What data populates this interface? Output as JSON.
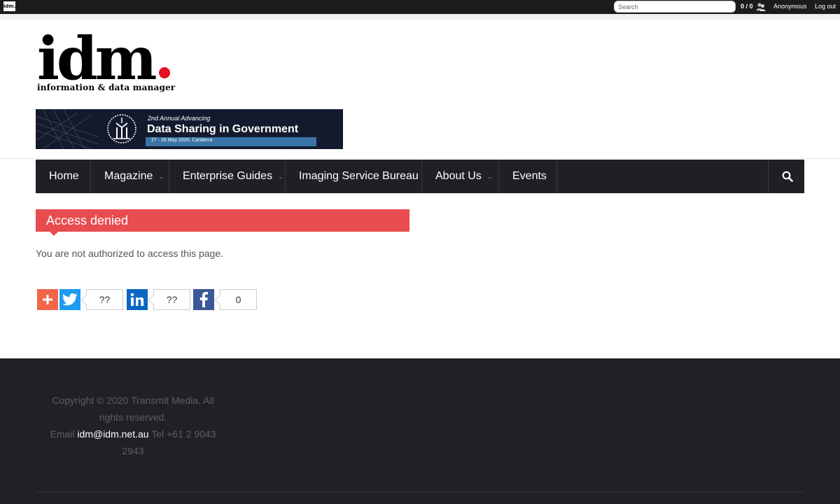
{
  "adminbar": {
    "logo_text": "idm.",
    "search_placeholder": "Search",
    "count": "0 / 0",
    "user": "Anonymous",
    "logout": "Log out"
  },
  "header": {
    "logo_word": "idm",
    "logo_tagline": "information & data manager"
  },
  "banner": {
    "kicker": "2nd Annual Advancing",
    "title": "Data Sharing in Government",
    "date": "27 - 28 May 2020, Canberra"
  },
  "nav": {
    "items": [
      {
        "label": "Home"
      },
      {
        "label": "Magazine"
      },
      {
        "label": "Enterprise Guides"
      },
      {
        "label": "Imaging Service Bureau"
      },
      {
        "label": "About Us"
      },
      {
        "label": "Events"
      }
    ]
  },
  "content": {
    "title": "Access denied",
    "message": "You are not authorized to access this page."
  },
  "share": {
    "twitter_count": "??",
    "linkedin_count": "??",
    "facebook_count": "0"
  },
  "footer": {
    "copyright": "Copyright © 2020 Transmit Media. All rights reserved.",
    "email_label": "Email",
    "email": "idm@idm.net.au",
    "phone": "Tel +61 2 9043 2943"
  },
  "colors": {
    "accent_red": "#e84c4f",
    "nav_bg": "#1f2023",
    "footer_bg": "#202124",
    "twitter": "#1d9bf0",
    "linkedin": "#0a66c2",
    "facebook": "#3b5998",
    "plus": "#f2654a"
  }
}
